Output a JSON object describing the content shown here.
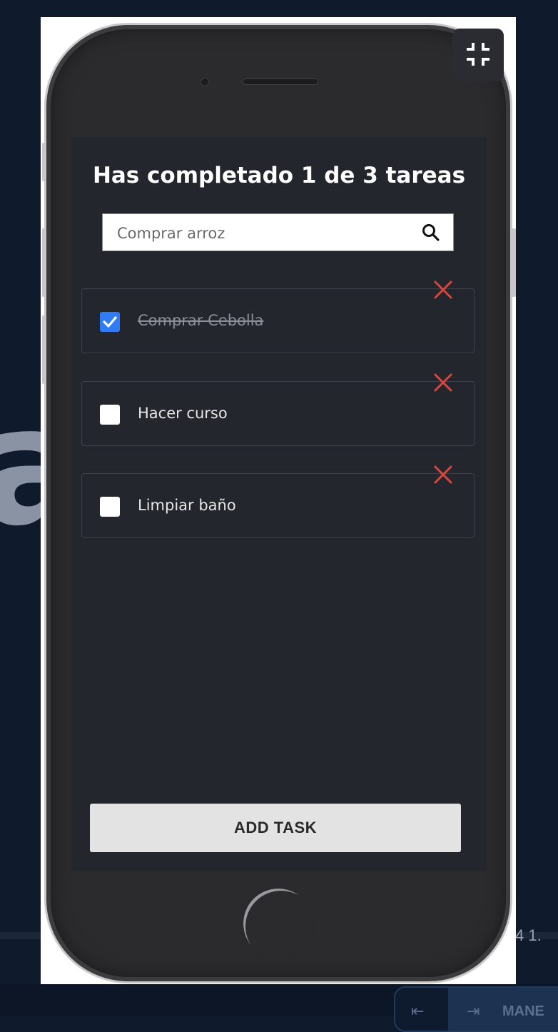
{
  "background": {
    "large_letter": "a",
    "side_numbers": "4   1.",
    "control_text": "MANE"
  },
  "app": {
    "title": "Has completado 1 de 3 tareas",
    "completed": 1,
    "total": 3,
    "search": {
      "placeholder": "Comprar arroz",
      "value": ""
    },
    "tasks": [
      {
        "label": "Comprar Cebolla",
        "completed": true
      },
      {
        "label": "Hacer curso",
        "completed": false
      },
      {
        "label": "Limpiar baño",
        "completed": false
      }
    ],
    "add_button_label": "ADD TASK"
  },
  "colors": {
    "screen_bg": "#23262d",
    "delete_accent": "#d9463e",
    "checkbox_checked": "#2f7cf6",
    "page_bg": "#0f1a2c"
  },
  "icons": {
    "collapse": "collapse-icon",
    "search": "search-icon",
    "delete": "close-icon",
    "check": "check-icon"
  }
}
